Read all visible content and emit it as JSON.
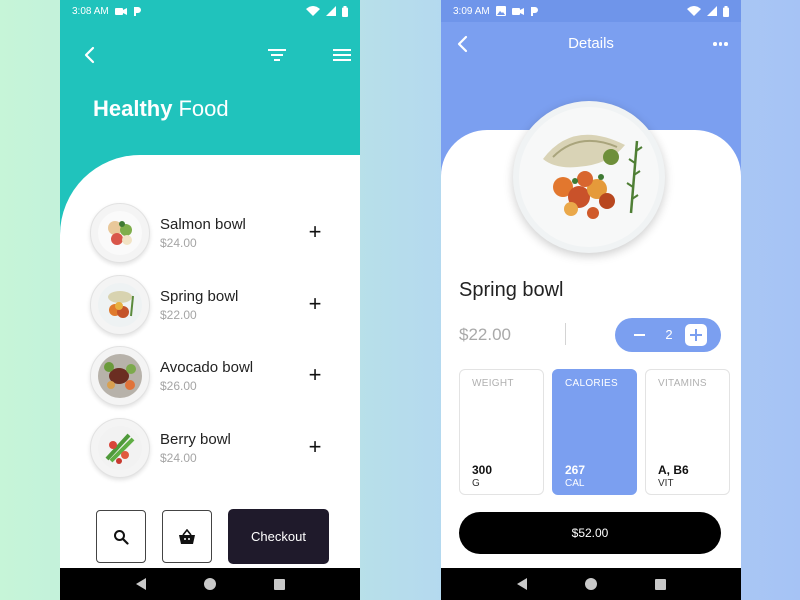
{
  "left_screen": {
    "status": {
      "time": "3:08 AM"
    },
    "header": {
      "title_bold": "Healthy",
      "title_light": "Food"
    },
    "foods": [
      {
        "name": "Salmon bowl",
        "price": "$24.00"
      },
      {
        "name": "Spring bowl",
        "price": "$22.00"
      },
      {
        "name": "Avocado bowl",
        "price": "$26.00"
      },
      {
        "name": "Berry bowl",
        "price": "$24.00"
      }
    ],
    "add_symbol": "+",
    "checkout_label": "Checkout",
    "colors": {
      "accent": "#20c3bc",
      "checkout_bg": "#1f1a2b"
    }
  },
  "right_screen": {
    "status": {
      "time": "3:09 AM"
    },
    "header": {
      "title": "Details"
    },
    "product": {
      "name": "Spring bowl",
      "price": "$22.00",
      "quantity": "2"
    },
    "stats": [
      {
        "label": "WEIGHT",
        "value": "300",
        "unit": "G",
        "active": false
      },
      {
        "label": "CALORIES",
        "value": "267",
        "unit": "CAL",
        "active": true
      },
      {
        "label": "VITAMINS",
        "value": "A, B6",
        "unit": "VIT",
        "active": false
      }
    ],
    "total_label": "$52.00",
    "colors": {
      "accent": "#7b9ff0",
      "button_bg": "#000000"
    }
  },
  "icons": {
    "back": "chevron-left-icon",
    "filter": "filter-icon",
    "menu": "hamburger-menu-icon",
    "more": "more-dots-icon",
    "search": "search-icon",
    "basket": "basket-icon"
  }
}
